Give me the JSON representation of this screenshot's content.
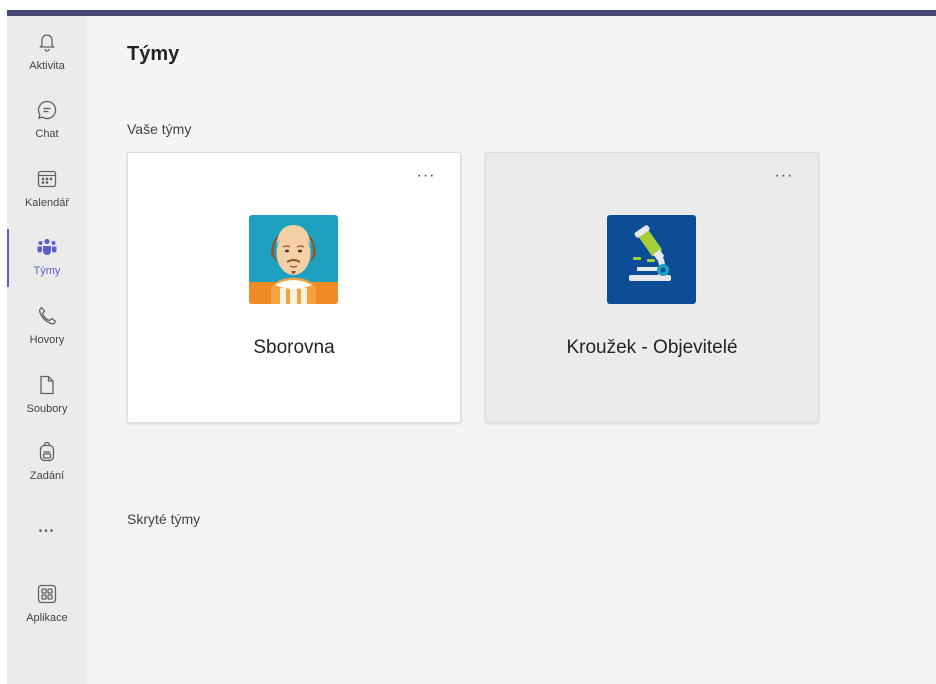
{
  "nav": {
    "items": [
      {
        "label": "Aktivita",
        "icon": "bell-icon"
      },
      {
        "label": "Chat",
        "icon": "chat-icon"
      },
      {
        "label": "Kalendář",
        "icon": "calendar-icon"
      },
      {
        "label": "Týmy",
        "icon": "teams-icon",
        "active": true
      },
      {
        "label": "Hovory",
        "icon": "phone-icon"
      },
      {
        "label": "Soubory",
        "icon": "file-icon"
      },
      {
        "label": "Zadání",
        "icon": "backpack-icon"
      }
    ],
    "more_label": "•••",
    "apps_label": "Aplikace"
  },
  "page": {
    "title": "Týmy",
    "your_teams_label": "Vaše týmy",
    "hidden_teams_label": "Skryté týmy"
  },
  "teams": [
    {
      "name": "Sborovna",
      "more": "···",
      "avatar": "shakespeare-avatar"
    },
    {
      "name": "Kroužek - Objevitelé",
      "more": "···",
      "avatar": "microscope-avatar"
    }
  ],
  "colors": {
    "accent": "#5b5fc7",
    "top_bar": "#464775",
    "rail_bg": "#ebebeb",
    "content_bg": "#f4f4f4",
    "card_white": "#ffffff",
    "card_hover": "#ebebeb",
    "logo_blue": "#0c4d96",
    "logo_teal": "#1ea1c1",
    "logo_orange": "#f08a24"
  }
}
